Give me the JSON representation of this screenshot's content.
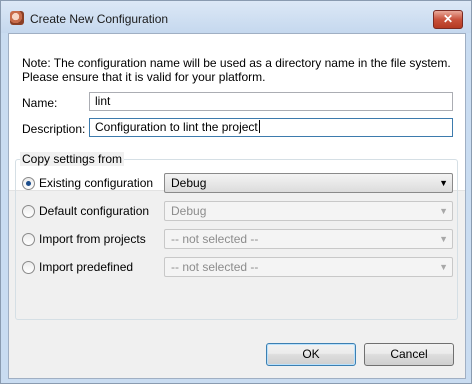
{
  "window": {
    "title": "Create New Configuration",
    "close_glyph": "✕",
    "icon": "eclipse-app-icon"
  },
  "note": {
    "line1": "Note: The configuration name will be used as a directory name in the file system.",
    "line2": "Please ensure that it is valid for your platform."
  },
  "form": {
    "name_label": "Name:",
    "name_value": "lint",
    "description_label": "Description:",
    "description_value": "Configuration to lint the project"
  },
  "copy_settings": {
    "title": "Copy settings from",
    "options": [
      {
        "label": "Existing configuration",
        "selected": true,
        "value": "Debug",
        "enabled": true
      },
      {
        "label": "Default configuration",
        "selected": false,
        "value": "Debug",
        "enabled": false
      },
      {
        "label": "Import from projects",
        "selected": false,
        "value": "-- not selected --",
        "enabled": false
      },
      {
        "label": "Import predefined",
        "selected": false,
        "value": "-- not selected --",
        "enabled": false
      }
    ],
    "dropdown_glyph": "▼"
  },
  "buttons": {
    "ok": "OK",
    "cancel": "Cancel"
  }
}
